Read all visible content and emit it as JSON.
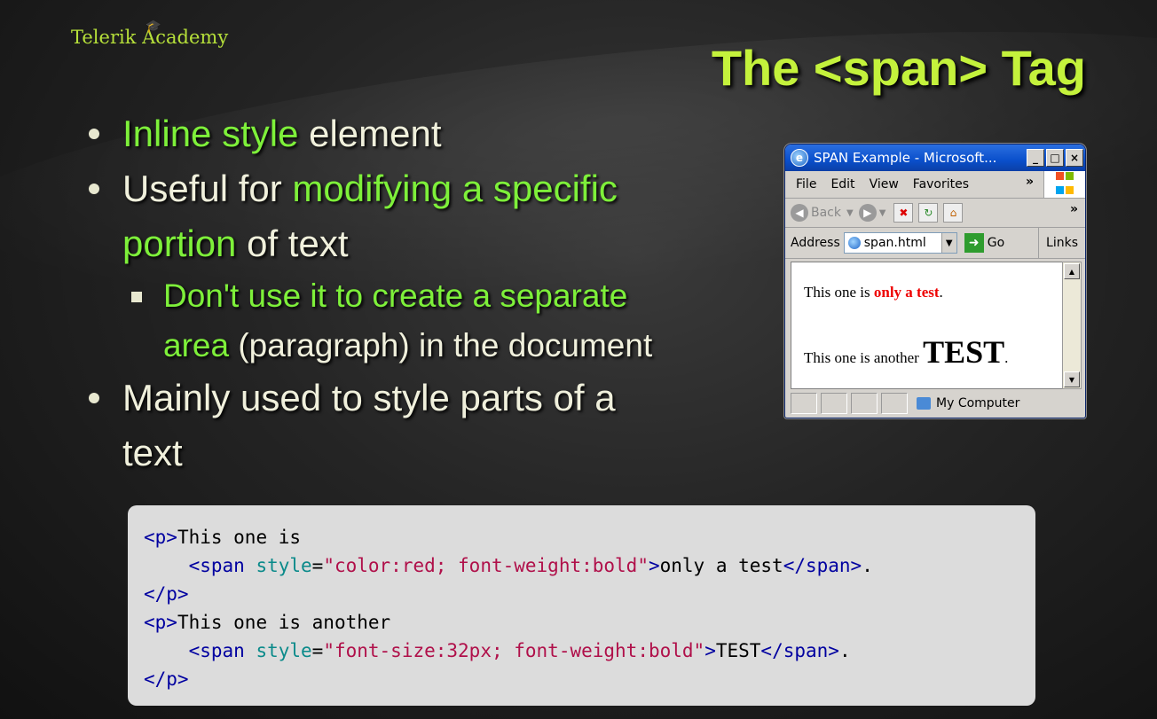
{
  "header": {
    "logo_text": "Telerik Academy",
    "title": "The <span> Tag"
  },
  "bullets": {
    "b1_hl": "Inline style",
    "b1_rest": " element",
    "b2_pre": "Useful for ",
    "b2_hl1": "modifying a specific",
    "b2_hl2": "portion",
    "b2_rest": " of text",
    "sub_hl1": "Don't use it to create a separate",
    "sub_hl2": "area",
    "sub_rest": " (paragraph) in the document",
    "b3_line1": "Mainly used to style parts of a",
    "b3_line2": "text"
  },
  "browser": {
    "window_title": "SPAN Example - Microsoft...",
    "menu": [
      "File",
      "Edit",
      "View",
      "Favorites"
    ],
    "back_label": "Back",
    "address_label": "Address",
    "address_value": "span.html",
    "go_label": "Go",
    "links_label": "Links",
    "p1_prefix": "This one is ",
    "p1_red": "only a test",
    "p1_suffix": ".",
    "p2_prefix": "This one is another ",
    "p2_big": "TEST",
    "p2_suffix": ".",
    "status_text": "My Computer"
  },
  "code": {
    "l1_tag": "<p>",
    "l1_text": "This one is",
    "l2_indent": "    ",
    "l2_open": "<span ",
    "l2_attr": "style",
    "l2_eq": "=",
    "l2_val": "\"color:red; font-weight:bold\"",
    "l2_close": ">",
    "l2_text": "only a test",
    "l2_end": "</span>",
    "l2_dot": ".",
    "l3_tag": "</p>",
    "l4_tag": "<p>",
    "l4_text": "This one is another",
    "l5_indent": "    ",
    "l5_open": "<span ",
    "l5_attr": "style",
    "l5_eq": "=",
    "l5_val": "\"font-size:32px; font-weight:bold\"",
    "l5_close": ">",
    "l5_text": "TEST",
    "l5_end": "</span>",
    "l5_dot": ".",
    "l6_tag": "</p>"
  }
}
